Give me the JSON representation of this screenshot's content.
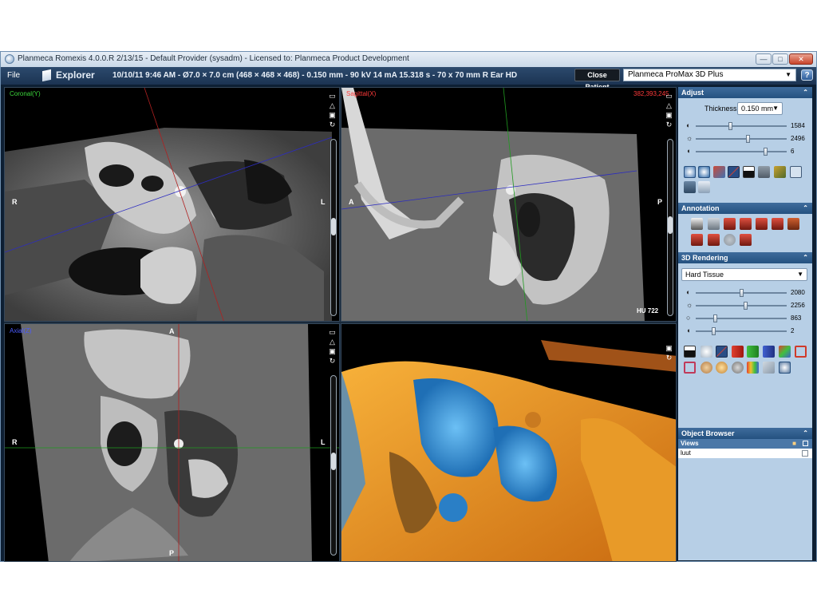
{
  "window": {
    "title": "Planmeca Romexis 4.0.0.R  2/13/15 - Default Provider (sysadm) - Licensed to: Planmeca Product Development"
  },
  "toolbar": {
    "file_menu": "File",
    "explorer_label": "Explorer",
    "study_info": "10/10/11 9:46 AM - Ø7.0 × 7.0 cm (468 × 468 × 468) - 0.150 mm - 90 kV 14 mA 15.318 s - 70 x 70 mm R Ear HD",
    "close_patient": "Close Patient",
    "device": "Planmeca ProMax 3D Plus",
    "help": "?"
  },
  "viewports": {
    "coronal": {
      "label": "Coronal(Y)",
      "label_color": "#3bd63b",
      "left": "R",
      "right": "L"
    },
    "sagittal": {
      "label": "Sagittal(X)",
      "label_color": "#ff3a3a",
      "coords": "382,393,245",
      "left": "A",
      "right": "P",
      "hu": "HU 722"
    },
    "axial": {
      "label": "Axial(Z)",
      "label_color": "#4b5bff",
      "left": "R",
      "right": "L",
      "top": "A",
      "bottom": "P"
    }
  },
  "adjust": {
    "header": "Adjust",
    "thickness_label": "Thickness",
    "thickness_value": "0.150 mm",
    "sliders": [
      {
        "icon": "contrast-icon",
        "value": "1584",
        "level": 0.38
      },
      {
        "icon": "brightness-icon",
        "value": "2496",
        "level": 0.58
      },
      {
        "icon": "gamma-icon",
        "value": "6",
        "level": 0.78
      }
    ]
  },
  "annotation": {
    "header": "Annotation"
  },
  "rendering": {
    "header": "3D Rendering",
    "preset": "Hard Tissue",
    "sliders": [
      {
        "icon": "contrast-icon",
        "value": "2080",
        "level": 0.5
      },
      {
        "icon": "brightness-icon",
        "value": "2256",
        "level": 0.55
      },
      {
        "icon": "opacity-icon",
        "value": "863",
        "level": 0.2
      },
      {
        "icon": "gamma-icon",
        "value": "2",
        "level": 0.18
      }
    ]
  },
  "object_browser": {
    "header": "Object Browser",
    "views_label": "Views",
    "items": [
      "luut"
    ]
  },
  "colors": {
    "panel_bg": "#b7cfe6",
    "header_blue": "#2a5685",
    "toolbar": "#223f61"
  }
}
